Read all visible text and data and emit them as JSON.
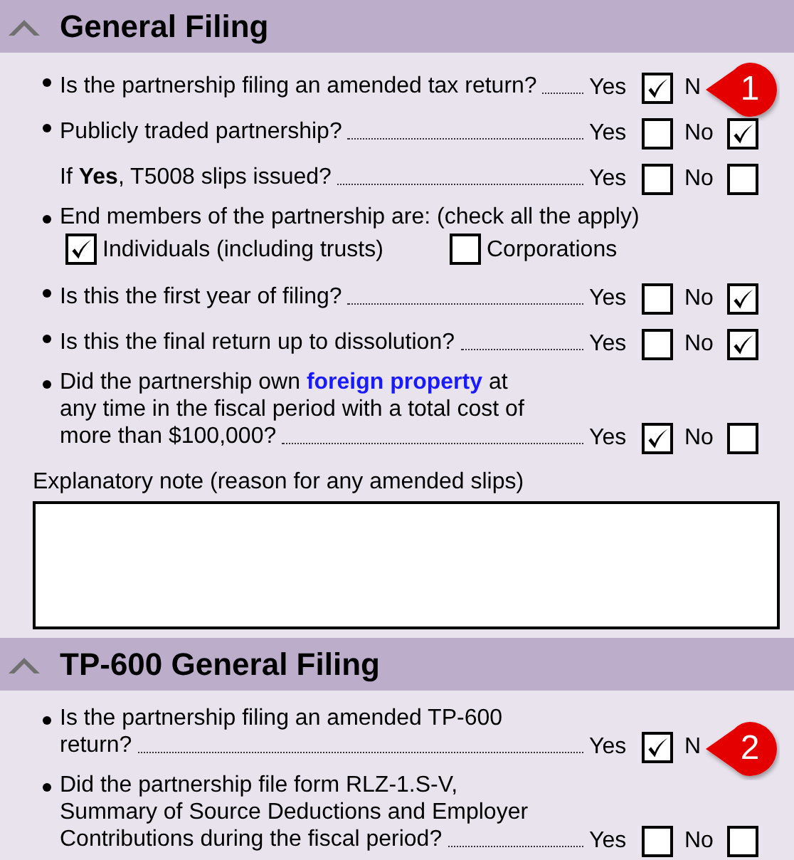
{
  "sections": [
    {
      "title": "General Filing",
      "expanded": true,
      "items": [
        {
          "kind": "yesno",
          "bullet": true,
          "lines": [
            "Is the partnership filing an amended tax return?"
          ],
          "yes_label": "Yes",
          "yes_checked": true,
          "no_label": "N",
          "callout": "1"
        },
        {
          "kind": "yesno",
          "bullet": true,
          "lines": [
            "Publicly traded partnership?"
          ],
          "yes_label": "Yes",
          "yes_checked": false,
          "no_label": "No",
          "no_checked": true
        },
        {
          "kind": "yesno",
          "bullet": false,
          "lines": [
            "If **Yes**, T5008 slips issued?"
          ],
          "yes_label": "Yes",
          "yes_checked": false,
          "no_label": "No",
          "no_checked": false
        },
        {
          "kind": "multi",
          "bullet": true,
          "lines": [
            "End members of the partnership are: (check all the apply)"
          ],
          "options": [
            {
              "label": "Individuals (including trusts)",
              "checked": true
            },
            {
              "label": "Corporations",
              "checked": false
            }
          ]
        },
        {
          "kind": "yesno",
          "bullet": true,
          "lines": [
            "Is this the first year of filing?"
          ],
          "yes_label": "Yes",
          "yes_checked": false,
          "no_label": "No",
          "no_checked": true
        },
        {
          "kind": "yesno",
          "bullet": true,
          "lines": [
            "Is this the final return up to dissolution?"
          ],
          "yes_label": "Yes",
          "yes_checked": false,
          "no_label": "No",
          "no_checked": true
        },
        {
          "kind": "yesno",
          "bullet": true,
          "lines": [
            [
              {
                "text": "Did the partnership own "
              },
              {
                "text": "foreign property",
                "link": true
              },
              {
                "text": " at"
              }
            ],
            "any time in the fiscal period with a total cost of",
            "more than $100,000?"
          ],
          "yes_label": "Yes",
          "yes_checked": true,
          "no_label": "No",
          "no_checked": false
        },
        {
          "kind": "note",
          "label": "Explanatory note (reason for any amended slips)"
        }
      ]
    },
    {
      "title": "TP-600 General Filing",
      "expanded": true,
      "items": [
        {
          "kind": "yesno",
          "bullet": true,
          "lines": [
            "Is the partnership filing an amended TP-600",
            "return?"
          ],
          "yes_label": "Yes",
          "yes_checked": true,
          "no_label": "N",
          "callout": "2"
        },
        {
          "kind": "yesno",
          "bullet": true,
          "lines": [
            "Did the partnership file form RLZ-1.S-V,",
            "Summary of Source Deductions and Employer",
            "Contributions during the fiscal period?"
          ],
          "yes_label": "Yes",
          "yes_checked": false,
          "no_label": "No",
          "no_checked": false
        }
      ]
    }
  ]
}
